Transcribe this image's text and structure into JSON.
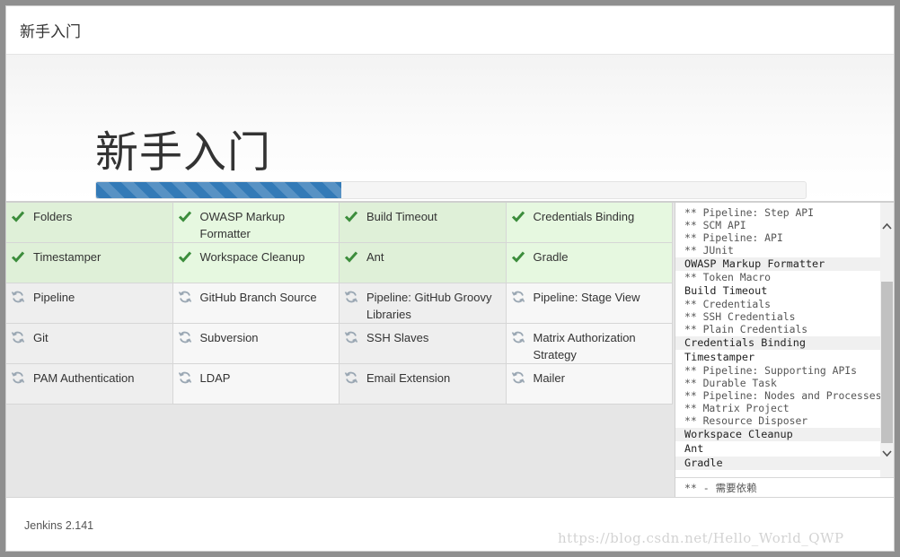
{
  "header": {
    "title": "新手入门"
  },
  "hero": {
    "title": "新手入门",
    "progress": 0.345
  },
  "colors": {
    "progress": "#337ab7",
    "success_check": "#3c8d3c",
    "pending_icon": "#9aa7b3"
  },
  "plugins": [
    {
      "name": "Folders",
      "status": "success"
    },
    {
      "name": "OWASP Markup Formatter",
      "status": "success"
    },
    {
      "name": "Build Timeout",
      "status": "success"
    },
    {
      "name": "Credentials Binding",
      "status": "success"
    },
    {
      "name": "Timestamper",
      "status": "success"
    },
    {
      "name": "Workspace Cleanup",
      "status": "success"
    },
    {
      "name": "Ant",
      "status": "success"
    },
    {
      "name": "Gradle",
      "status": "success"
    },
    {
      "name": "Pipeline",
      "status": "pending"
    },
    {
      "name": "GitHub Branch Source",
      "status": "pending"
    },
    {
      "name": "Pipeline: GitHub Groovy Libraries",
      "status": "pending"
    },
    {
      "name": "Pipeline: Stage View",
      "status": "pending"
    },
    {
      "name": "Git",
      "status": "pending"
    },
    {
      "name": "Subversion",
      "status": "pending"
    },
    {
      "name": "SSH Slaves",
      "status": "pending"
    },
    {
      "name": "Matrix Authorization Strategy",
      "status": "pending"
    },
    {
      "name": "PAM Authentication",
      "status": "pending"
    },
    {
      "name": "LDAP",
      "status": "pending"
    },
    {
      "name": "Email Extension",
      "status": "pending"
    },
    {
      "name": "Mailer",
      "status": "pending"
    }
  ],
  "log": [
    {
      "text": "** Pipeline: Step API",
      "main": false
    },
    {
      "text": "** SCM API",
      "main": false
    },
    {
      "text": "** Pipeline: API",
      "main": false
    },
    {
      "text": "** JUnit",
      "main": false
    },
    {
      "text": "OWASP Markup Formatter",
      "main": true
    },
    {
      "text": "** Token Macro",
      "main": false
    },
    {
      "text": "Build Timeout",
      "main": true
    },
    {
      "text": "** Credentials",
      "main": false
    },
    {
      "text": "** SSH Credentials",
      "main": false
    },
    {
      "text": "** Plain Credentials",
      "main": false
    },
    {
      "text": "Credentials Binding",
      "main": true
    },
    {
      "text": "Timestamper",
      "main": true
    },
    {
      "text": "** Pipeline: Supporting APIs",
      "main": false
    },
    {
      "text": "** Durable Task",
      "main": false
    },
    {
      "text": "** Pipeline: Nodes and Processes",
      "main": false
    },
    {
      "text": "** Matrix Project",
      "main": false
    },
    {
      "text": "** Resource Disposer",
      "main": false
    },
    {
      "text": "Workspace Cleanup",
      "main": true
    },
    {
      "text": "Ant",
      "main": true
    },
    {
      "text": "Gradle",
      "main": true
    }
  ],
  "legend": "** - 需要依赖",
  "footer": {
    "version": "Jenkins 2.141"
  },
  "watermark": "https://blog.csdn.net/Hello_World_QWP"
}
